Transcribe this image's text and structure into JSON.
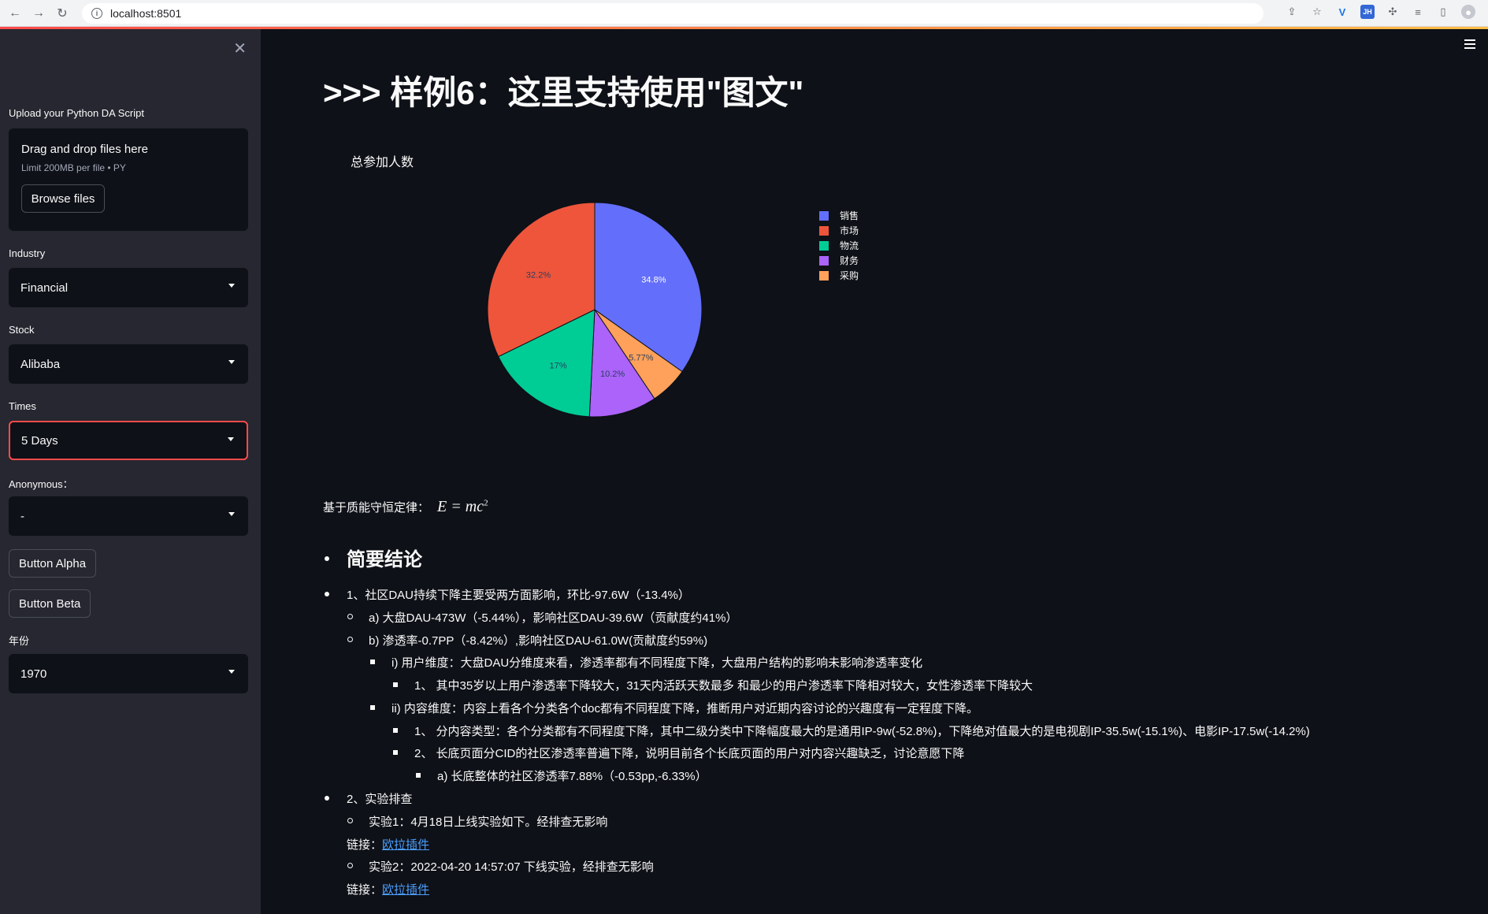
{
  "browser": {
    "url": "localhost:8501"
  },
  "sidebar": {
    "upload_label": "Upload your Python DA Script",
    "drop_title": "Drag and drop files here",
    "drop_sub": "Limit 200MB per file • PY",
    "browse_label": "Browse files",
    "industry_label": "Industry",
    "industry_value": "Financial",
    "stock_label": "Stock",
    "stock_value": "Alibaba",
    "times_label": "Times",
    "times_value": "5 Days",
    "anonymous_label": "Anonymous：",
    "anonymous_value": "-",
    "button_alpha": "Button Alpha",
    "button_beta": "Button Beta",
    "year_label": "年份",
    "year_value": "1970"
  },
  "main": {
    "title": ">>> 样例6：这里支持使用\"图文\"",
    "formula_prefix": "基于质能守恒定律：",
    "formula_text": "E = mc",
    "formula_exp": "2",
    "summary_heading": "简要结论",
    "items": {
      "l1": "1、社区DAU持续下降主要受两方面影响，环比-97.6W（-13.4%）",
      "l1a": "a) 大盘DAU-473W（-5.44%），影响社区DAU-39.6W（贡献度约41%）",
      "l1b": "b) 渗透率-0.7PP（-8.42%）,影响社区DAU-61.0W(贡献度约59%)",
      "l1bi": "i) 用户维度：大盘DAU分维度来看，渗透率都有不同程度下降，大盘用户结构的影响未影响渗透率变化",
      "l1bi1": "1、 其中35岁以上用户渗透率下降较大，31天内活跃天数最多 和最少的用户渗透率下降相对较大，女性渗透率下降较大",
      "l1bii": "ii) 内容维度：内容上看各个分类各个doc都有不同程度下降，推断用户对近期内容讨论的兴趣度有一定程度下降。",
      "l1bii1": "1、 分内容类型：各个分类都有不同程度下降，其中二级分类中下降幅度最大的是通用IP-9w(-52.8%)，下降绝对值最大的是电视剧IP-35.5w(-15.1%)、电影IP-17.5w(-14.2%)",
      "l1bii2": "2、 长底页面分CID的社区渗透率普遍下降，说明目前各个长底页面的用户对内容兴趣缺乏，讨论意愿下降",
      "l1bii2a": "a) 长底整体的社区渗透率7.88%（-0.53pp,-6.33%）",
      "l2": "2、实验排查",
      "l2a": "实验1：4月18日上线实验如下。经排查无影响",
      "link_prefix_1": "链接：",
      "link_text_1": "欧拉插件",
      "l2b": "实验2：2022-04-20 14:57:07 下线实验，经排查无影响",
      "link_prefix_2": "链接：",
      "link_text_2": "欧拉插件"
    }
  },
  "chart_data": {
    "type": "pie",
    "title": "总参加人数",
    "categories": [
      "销售",
      "市场",
      "物流",
      "财务",
      "采购"
    ],
    "values": [
      34.8,
      32.2,
      17.0,
      10.2,
      5.77
    ],
    "labels": [
      "34.8%",
      "32.2%",
      "17%",
      "10.2%",
      "5.77%"
    ],
    "colors": [
      "#636efa",
      "#ef553b",
      "#00cc96",
      "#ab63fa",
      "#ffa15a"
    ],
    "slice_order": [
      "销售",
      "采购",
      "财务",
      "物流",
      "市场"
    ],
    "legend_position": "right"
  }
}
